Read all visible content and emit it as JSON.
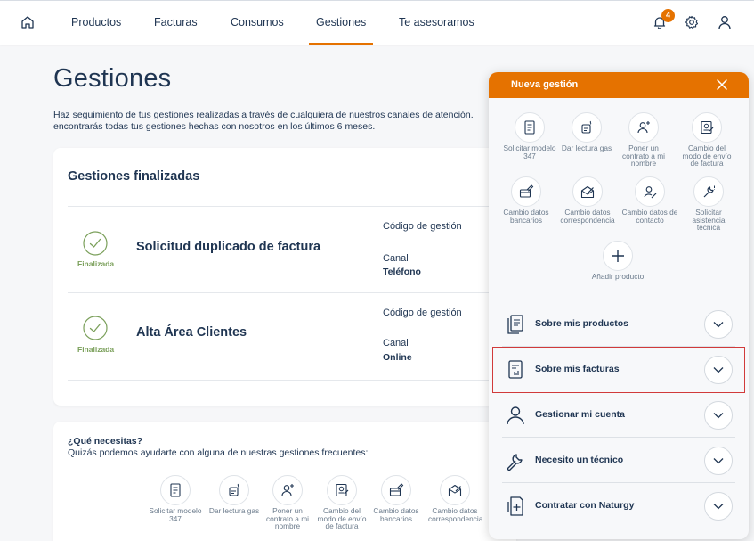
{
  "nav": {
    "items": [
      "Productos",
      "Facturas",
      "Consumos",
      "Gestiones",
      "Te asesoramos"
    ],
    "active": "Gestiones",
    "notifications_count": "4"
  },
  "page": {
    "title": "Gestiones",
    "description_line1": "Haz seguimiento de tus gestiones realizadas a través de cualquiera de nuestros canales de atención.",
    "description_line2": "encontrarás todas tus gestiones hechas con nosotros en los últimos 6 meses."
  },
  "finished": {
    "heading": "Gestiones finalizadas",
    "rows": [
      {
        "status": "Finalizada",
        "title": "Solicitud duplicado de factura",
        "code_label": "Código de gestión",
        "channel_label": "Canal",
        "channel": "Teléfono"
      },
      {
        "status": "Finalizada",
        "title": "Alta Área Clientes",
        "code_label": "Código de gestión",
        "channel_label": "Canal",
        "channel": "Online"
      }
    ]
  },
  "needs": {
    "question": "¿Qué necesitas?",
    "subtitle": "Quizás podemos ayudarte con alguna de nuestras gestiones frecuentes:",
    "items": [
      {
        "label": "Solicitar modelo 347",
        "icon": "document-347-icon"
      },
      {
        "label": "Dar lectura gas",
        "icon": "gas-meter-icon"
      },
      {
        "label": "Poner un contrato a mi nombre",
        "icon": "user-add-icon"
      },
      {
        "label": "Cambio del modo de envío de factura",
        "icon": "invoice-send-icon"
      },
      {
        "label": "Cambio datos bancarios",
        "icon": "bank-card-edit-icon"
      },
      {
        "label": "Cambio datos correspondencia",
        "icon": "mail-edit-icon"
      }
    ]
  },
  "panel": {
    "title": "Nueva gestión",
    "actions": [
      {
        "label": "Solicitar modelo 347",
        "icon": "document-347-icon"
      },
      {
        "label": "Dar lectura gas",
        "icon": "gas-meter-icon"
      },
      {
        "label": "Poner un contrato a mi nombre",
        "icon": "user-add-icon"
      },
      {
        "label": "Cambio del modo de envío de factura",
        "icon": "invoice-send-icon"
      },
      {
        "label": "Cambio datos bancarios",
        "icon": "bank-card-edit-icon"
      },
      {
        "label": "Cambio datos correspondencia",
        "icon": "mail-edit-icon"
      },
      {
        "label": "Cambio datos de contacto",
        "icon": "contact-edit-icon"
      },
      {
        "label": "Solicitar asistencia técnica",
        "icon": "wrench-icon"
      },
      {
        "label": "Añadir producto",
        "icon": "plus-icon"
      }
    ],
    "sections": [
      {
        "label": "Sobre mis productos",
        "icon": "documents-icon"
      },
      {
        "label": "Sobre mis facturas",
        "icon": "invoice-icon"
      },
      {
        "label": "Gestionar mi cuenta",
        "icon": "user-icon"
      },
      {
        "label": "Necesito un técnico",
        "icon": "wrench-icon"
      },
      {
        "label": "Contratar con Naturgy",
        "icon": "contract-add-icon"
      }
    ]
  },
  "colors": {
    "accent": "#e57200",
    "text": "#1f3552",
    "success": "#7ba05b",
    "highlight": "#d13a3a"
  }
}
